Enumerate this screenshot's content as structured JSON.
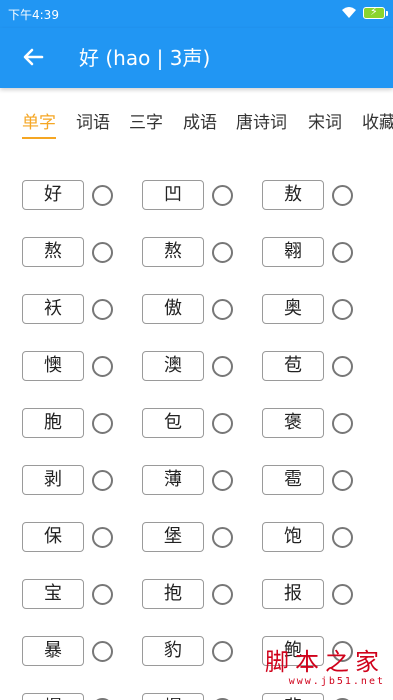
{
  "status_bar": {
    "time": "下午4:39",
    "wifi_icon": "wifi-icon",
    "battery_icon": "battery-charging-icon"
  },
  "app_bar": {
    "back_icon": "arrow-left-icon",
    "title": "好 (hao | 3声)"
  },
  "tabs": [
    "单字",
    "词语",
    "三字",
    "成语",
    "唐诗词",
    "宋词",
    "收藏"
  ],
  "active_tab": "单字",
  "characters": [
    [
      "好",
      "凹",
      "敖"
    ],
    [
      "熬",
      "熬",
      "翱"
    ],
    [
      "袄",
      "傲",
      "奥"
    ],
    [
      "懊",
      "澳",
      "苞"
    ],
    [
      "胞",
      "包",
      "褒"
    ],
    [
      "剥",
      "薄",
      "雹"
    ],
    [
      "保",
      "堡",
      "饱"
    ],
    [
      "宝",
      "抱",
      "报"
    ],
    [
      "暴",
      "豹",
      "鲍"
    ],
    [
      "爆",
      "爆",
      "悲"
    ]
  ],
  "watermark": {
    "text": "脚本之家",
    "url": "www.jb51.net"
  },
  "colors": {
    "primary": "#2196f3",
    "accent": "#f5a623",
    "watermark": "#d0021b"
  }
}
